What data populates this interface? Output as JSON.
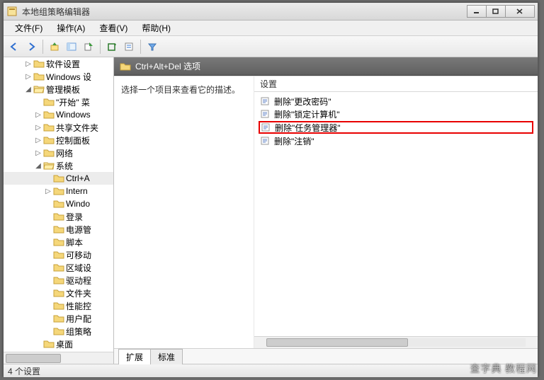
{
  "window": {
    "title": "本地组策略编辑器"
  },
  "menubar": {
    "file": "文件(F)",
    "action": "操作(A)",
    "view": "查看(V)",
    "help": "帮助(H)"
  },
  "header": {
    "path": "Ctrl+Alt+Del 选项"
  },
  "tree": {
    "items": [
      {
        "indent": 2,
        "tw": "▷",
        "label": "软件设置"
      },
      {
        "indent": 2,
        "tw": "▷",
        "label": "Windows 设"
      },
      {
        "indent": 2,
        "tw": "◢",
        "label": "管理模板"
      },
      {
        "indent": 3,
        "tw": "",
        "label": "\"开始\" 菜"
      },
      {
        "indent": 3,
        "tw": "▷",
        "label": "Windows"
      },
      {
        "indent": 3,
        "tw": "▷",
        "label": "共享文件夹"
      },
      {
        "indent": 3,
        "tw": "▷",
        "label": "控制面板"
      },
      {
        "indent": 3,
        "tw": "▷",
        "label": "网络"
      },
      {
        "indent": 3,
        "tw": "◢",
        "label": "系统"
      },
      {
        "indent": 4,
        "tw": "",
        "label": "Ctrl+A",
        "sel": true
      },
      {
        "indent": 4,
        "tw": "▷",
        "label": "Intern"
      },
      {
        "indent": 4,
        "tw": "",
        "label": "Windo"
      },
      {
        "indent": 4,
        "tw": "",
        "label": "登录"
      },
      {
        "indent": 4,
        "tw": "",
        "label": "电源管"
      },
      {
        "indent": 4,
        "tw": "",
        "label": "脚本"
      },
      {
        "indent": 4,
        "tw": "",
        "label": "可移动"
      },
      {
        "indent": 4,
        "tw": "",
        "label": "区域设"
      },
      {
        "indent": 4,
        "tw": "",
        "label": "驱动程"
      },
      {
        "indent": 4,
        "tw": "",
        "label": "文件夹"
      },
      {
        "indent": 4,
        "tw": "",
        "label": "性能控"
      },
      {
        "indent": 4,
        "tw": "",
        "label": "用户配"
      },
      {
        "indent": 4,
        "tw": "",
        "label": "组策略"
      },
      {
        "indent": 3,
        "tw": "",
        "label": "桌面"
      }
    ]
  },
  "detail": {
    "desc": "选择一个项目来查看它的描述。",
    "col_header": "设置",
    "items": [
      {
        "label": "删除\"更改密码\""
      },
      {
        "label": "删除\"锁定计算机\""
      },
      {
        "label": "删除\"任务管理器\"",
        "hl": true
      },
      {
        "label": "删除\"注销\""
      }
    ]
  },
  "tabs": {
    "extended": "扩展",
    "standard": "标准"
  },
  "status": {
    "text": "4 个设置"
  },
  "watermark": "查字典 教程网"
}
